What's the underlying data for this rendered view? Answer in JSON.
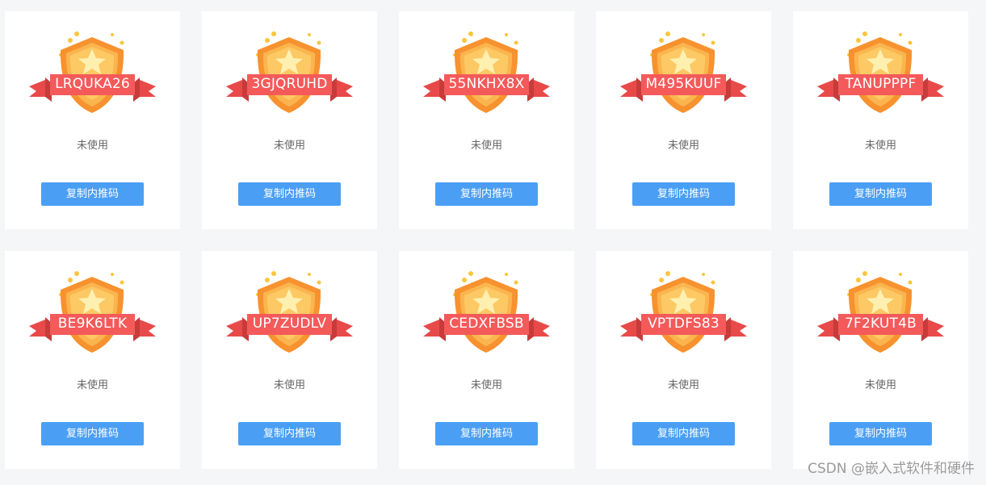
{
  "cards": [
    {
      "code": "LRQUKA26",
      "status": "未使用",
      "button_label": "复制内推码"
    },
    {
      "code": "3GJQRUHD",
      "status": "未使用",
      "button_label": "复制内推码"
    },
    {
      "code": "55NKHX8X",
      "status": "未使用",
      "button_label": "复制内推码"
    },
    {
      "code": "M495KUUF",
      "status": "未使用",
      "button_label": "复制内推码"
    },
    {
      "code": "TANUPPPF",
      "status": "未使用",
      "button_label": "复制内推码"
    },
    {
      "code": "BE9K6LTK",
      "status": "未使用",
      "button_label": "复制内推码"
    },
    {
      "code": "UP7ZUDLV",
      "status": "未使用",
      "button_label": "复制内推码"
    },
    {
      "code": "CEDXFBSB",
      "status": "未使用",
      "button_label": "复制内推码"
    },
    {
      "code": "VPTDFS83",
      "status": "未使用",
      "button_label": "复制内推码"
    },
    {
      "code": "7F2KUT4B",
      "status": "未使用",
      "button_label": "复制内推码"
    }
  ],
  "watermark": "CSDN @嵌入式软件和硬件",
  "colors": {
    "button": "#4a9ff5",
    "ribbon": "#f45a5a",
    "shield": "#f7922f",
    "page_background": "#f5f6f8"
  },
  "icons": {
    "badge": "shield-star-badge-icon"
  }
}
